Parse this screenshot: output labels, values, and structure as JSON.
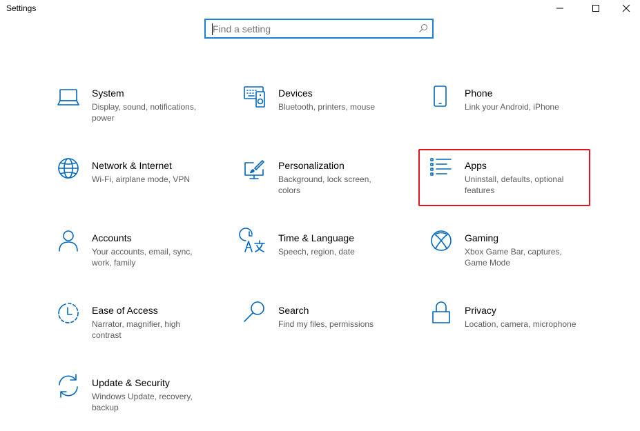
{
  "window": {
    "title": "Settings"
  },
  "search": {
    "placeholder": "Find a setting"
  },
  "tiles": [
    {
      "title": "System",
      "desc": "Display, sound, notifications, power",
      "icon": "laptop-icon"
    },
    {
      "title": "Devices",
      "desc": "Bluetooth, printers, mouse",
      "icon": "keyboard-speaker-icon"
    },
    {
      "title": "Phone",
      "desc": "Link your Android, iPhone",
      "icon": "phone-icon"
    },
    {
      "title": "Network & Internet",
      "desc": "Wi-Fi, airplane mode, VPN",
      "icon": "globe-icon"
    },
    {
      "title": "Personalization",
      "desc": "Background, lock screen, colors",
      "icon": "paint-brush-icon"
    },
    {
      "title": "Apps",
      "desc": "Uninstall, defaults, optional features",
      "icon": "apps-list-icon"
    },
    {
      "title": "Accounts",
      "desc": "Your accounts, email, sync, work, family",
      "icon": "person-icon"
    },
    {
      "title": "Time & Language",
      "desc": "Speech, region, date",
      "icon": "time-language-icon"
    },
    {
      "title": "Gaming",
      "desc": "Xbox Game Bar, captures, Game Mode",
      "icon": "xbox-icon"
    },
    {
      "title": "Ease of Access",
      "desc": "Narrator, magnifier, high contrast",
      "icon": "ease-of-access-icon"
    },
    {
      "title": "Search",
      "desc": "Find my files, permissions",
      "icon": "magnifier-icon"
    },
    {
      "title": "Privacy",
      "desc": "Location, camera, microphone",
      "icon": "lock-icon"
    },
    {
      "title": "Update & Security",
      "desc": "Windows Update, recovery, backup",
      "icon": "sync-arrows-icon"
    }
  ],
  "highlight": {
    "target": "Apps",
    "color": "#e0141e"
  },
  "colors": {
    "accent": "#0067c0",
    "search_border": "#1a7fd6"
  }
}
